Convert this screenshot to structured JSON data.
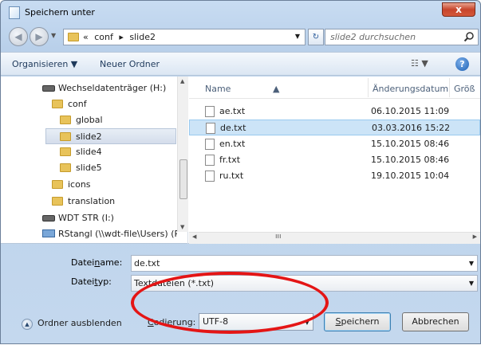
{
  "window": {
    "title": "Speichern unter",
    "close_label": "x"
  },
  "address": {
    "crumbs": [
      "«",
      "conf",
      "▸",
      "slide2"
    ],
    "search_placeholder": "slide2 durchsuchen"
  },
  "toolbar": {
    "organize": "Organisieren ▼",
    "new_folder": "Neuer Ordner",
    "view": "☷ ▼",
    "help": "?"
  },
  "nav_tree": [
    {
      "label": "Wechseldatenträger (H:)",
      "type": "drive"
    },
    {
      "label": "conf",
      "type": "folder"
    },
    {
      "label": "global",
      "type": "folder"
    },
    {
      "label": "slide2",
      "type": "folder",
      "selected": true
    },
    {
      "label": "slide4",
      "type": "folder"
    },
    {
      "label": "slide5",
      "type": "folder"
    },
    {
      "label": "icons",
      "type": "folder"
    },
    {
      "label": "translation",
      "type": "folder"
    },
    {
      "label": "WDT STR (I:)",
      "type": "drive"
    },
    {
      "label": "RStangl (\\\\wdt-file\\Users) (P:",
      "type": "network"
    }
  ],
  "columns": {
    "name": "Name",
    "date": "Änderungsdatum",
    "size": "Größ"
  },
  "files": [
    {
      "name": "ae.txt",
      "date": "06.10.2015 11:09"
    },
    {
      "name": "de.txt",
      "date": "03.03.2016 15:22",
      "selected": true
    },
    {
      "name": "en.txt",
      "date": "15.10.2015 08:46"
    },
    {
      "name": "fr.txt",
      "date": "15.10.2015 08:46"
    },
    {
      "name": "ru.txt",
      "date": "19.10.2015 10:04"
    }
  ],
  "form": {
    "filename_label_pre": "Datei",
    "filename_label_ul": "n",
    "filename_label_post": "ame:",
    "filename_value": "de.txt",
    "filetype_label_pre": "Datei",
    "filetype_label_ul": "t",
    "filetype_label_post": "yp:",
    "filetype_value": "Textdateien (*.txt)"
  },
  "bottom": {
    "hide_folders": "Ordner ausblenden",
    "encoding_label_ul": "C",
    "encoding_label_post": "odierung:",
    "encoding_value": "UTF-8",
    "save_ul": "S",
    "save_post": "peichern",
    "cancel": "Abbrechen"
  }
}
